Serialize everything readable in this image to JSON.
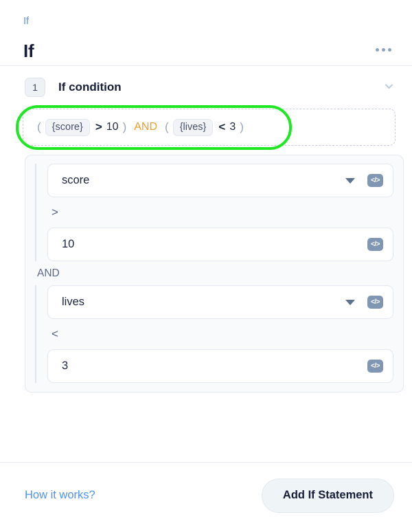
{
  "header": {
    "breadcrumb": "If",
    "title": "If",
    "overflow_icon": "ellipsis-icon"
  },
  "section": {
    "step_number": "1",
    "title": "If condition",
    "collapse_icon": "chevron-down-icon"
  },
  "preview": {
    "open_paren": "(",
    "close_paren": ")",
    "group1": {
      "variable": "{score}",
      "operator": ">",
      "value": "10"
    },
    "logic": "AND",
    "group2": {
      "variable": "{lives}",
      "operator": "<",
      "value": "3"
    },
    "annotation_color": "#1ee821"
  },
  "conditions": {
    "logic_label": "AND",
    "code_icon_label": "</>",
    "rows": [
      {
        "field_value": "score",
        "operator": ">",
        "value": "10"
      },
      {
        "field_value": "lives",
        "operator": "<",
        "value": "3"
      }
    ]
  },
  "footer": {
    "how_it_works": "How it works?",
    "add_button": "Add If Statement"
  }
}
